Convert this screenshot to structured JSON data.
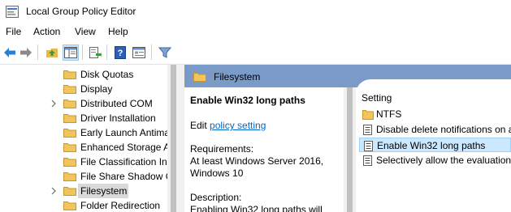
{
  "window": {
    "title": "Local Group Policy Editor"
  },
  "menu": {
    "items": [
      "File",
      "Action",
      "View",
      "Help"
    ]
  },
  "toolbar": {
    "buttons": [
      "back-icon",
      "forward-icon",
      "up-folder-icon",
      "show-hide-tree-icon",
      "export-list-icon",
      "help-icon",
      "properties-icon",
      "filter-icon"
    ]
  },
  "tree": {
    "items": [
      {
        "label": "Disk Quotas",
        "expandable": false
      },
      {
        "label": "Display",
        "expandable": false
      },
      {
        "label": "Distributed COM",
        "expandable": true
      },
      {
        "label": "Driver Installation",
        "expandable": false
      },
      {
        "label": "Early Launch Antimalware",
        "expandable": false
      },
      {
        "label": "Enhanced Storage Access",
        "expandable": false
      },
      {
        "label": "File Classification Infrastructure",
        "expandable": false
      },
      {
        "label": "File Share Shadow Copy Provider",
        "expandable": false
      },
      {
        "label": "Filesystem",
        "expandable": true,
        "selected": true
      },
      {
        "label": "Folder Redirection",
        "expandable": false
      }
    ]
  },
  "details": {
    "header": "Filesystem",
    "setting_title": "Enable Win32 long paths",
    "edit_prefix": "Edit",
    "edit_link": "policy setting",
    "requirements_label": "Requirements:",
    "requirements_value": "At least Windows Server 2016, Windows 10",
    "description_label": "Description:",
    "description_text": "Enabling Win32 long paths will"
  },
  "list": {
    "column_header": "Setting",
    "rows": [
      {
        "label": "NTFS",
        "icon": "folder-icon",
        "selected": false
      },
      {
        "label": "Disable delete notifications on all volumes",
        "icon": "policy-setting-icon",
        "selected": false
      },
      {
        "label": "Enable Win32 long paths",
        "icon": "policy-setting-icon",
        "selected": true
      },
      {
        "label": "Selectively allow the evaluation of a symbolic link",
        "icon": "policy-setting-icon",
        "selected": false
      }
    ]
  },
  "colors": {
    "header_band": "#7a9ac8",
    "selection": "#cce8ff",
    "link": "#0066cc",
    "folder": "#f2c55c"
  }
}
